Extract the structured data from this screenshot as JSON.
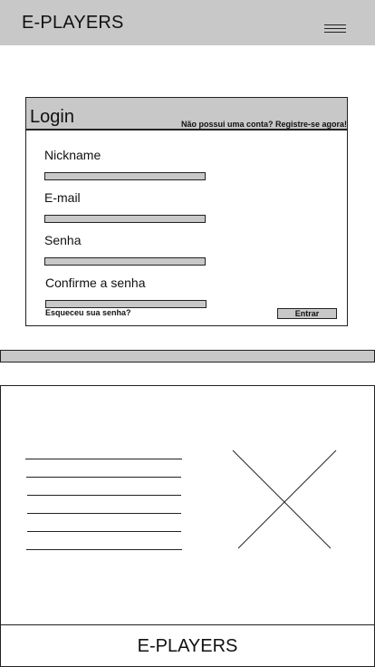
{
  "header": {
    "brand": "E-PLAYERS",
    "menu_icon": "hamburger-menu-icon"
  },
  "login": {
    "title": "Login",
    "register_link": "Não possui uma conta? Registre-se agora!",
    "fields": [
      {
        "label": "Nickname",
        "value": "",
        "placeholder": ""
      },
      {
        "label": "E-mail",
        "value": "",
        "placeholder": ""
      },
      {
        "label": "Senha",
        "value": "",
        "placeholder": ""
      },
      {
        "label": "Confirme a senha",
        "value": "",
        "placeholder": ""
      }
    ],
    "forgot_link": "Esqueceu sua senha?",
    "submit_label": "Entrar"
  },
  "content": {
    "text_placeholder_lines": 6,
    "image_placeholder_icon": "image-placeholder-x-icon"
  },
  "footer": {
    "brand": "E-PLAYERS"
  },
  "colors": {
    "header_bg": "#c8c8c8",
    "input_bg": "#c8c8c8",
    "border": "#222222",
    "page_bg": "#ffffff"
  }
}
